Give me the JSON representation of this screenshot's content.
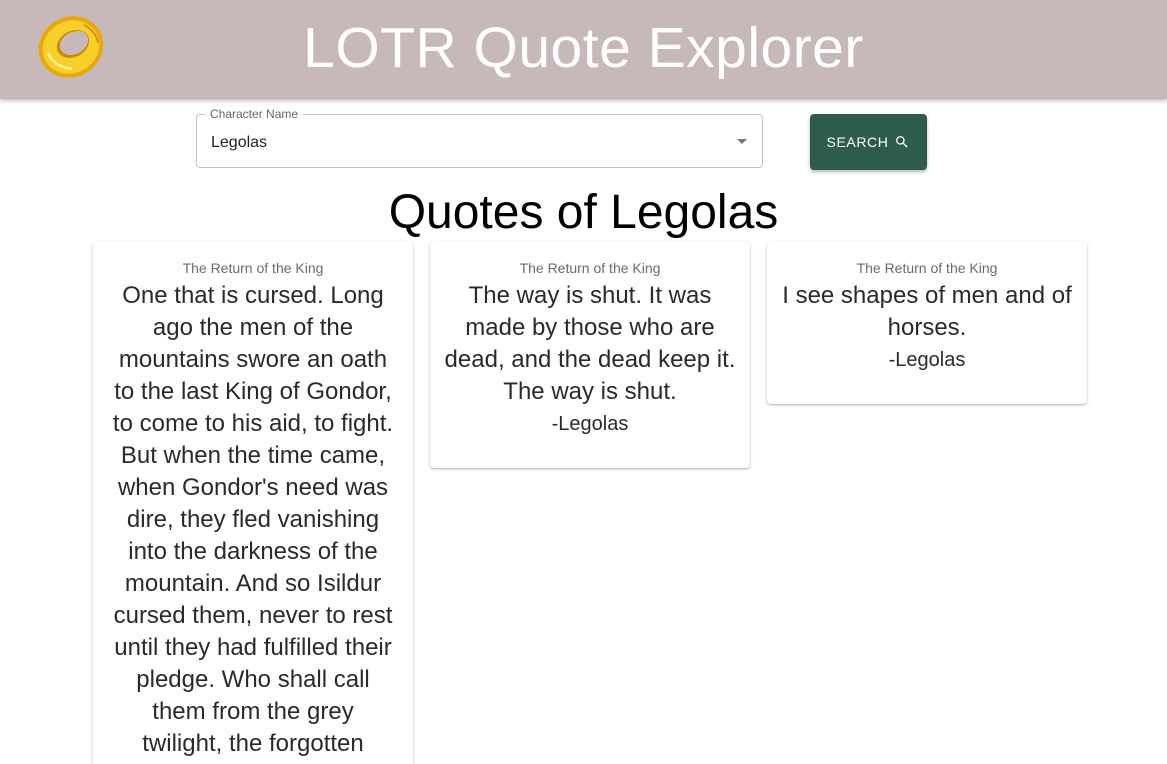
{
  "header": {
    "title": "LOTR Quote Explorer",
    "logo_icon": "one-ring-icon"
  },
  "search": {
    "label": "Character Name",
    "value": "Legolas",
    "button_label": "SEARCH",
    "button_icon": "search-icon"
  },
  "results": {
    "title": "Quotes of Legolas",
    "cards": [
      {
        "movie": "The Return of the King",
        "quote": "One that is cursed. Long ago the men of the mountains swore an oath to the last King of Gondor, to come to his aid, to fight. But when the time came, when Gondor's need was dire, they fled vanishing into the darkness of the mountain. And so Isildur cursed them, never to rest until they had fulfilled their pledge. Who shall call them from the grey twilight, the forgotten people? The"
      },
      {
        "movie": "The Return of the King",
        "quote": "The way is shut. It was made by those who are dead, and the dead keep it. The way is shut.",
        "author": "-Legolas"
      },
      {
        "movie": "The Return of the King",
        "quote": "I see shapes of men and of horses.",
        "author": "-Legolas"
      }
    ]
  },
  "colors": {
    "header_bg": "#c7b9b9",
    "button_bg": "#2e5c4c",
    "ring_gold": "#f5c518"
  }
}
